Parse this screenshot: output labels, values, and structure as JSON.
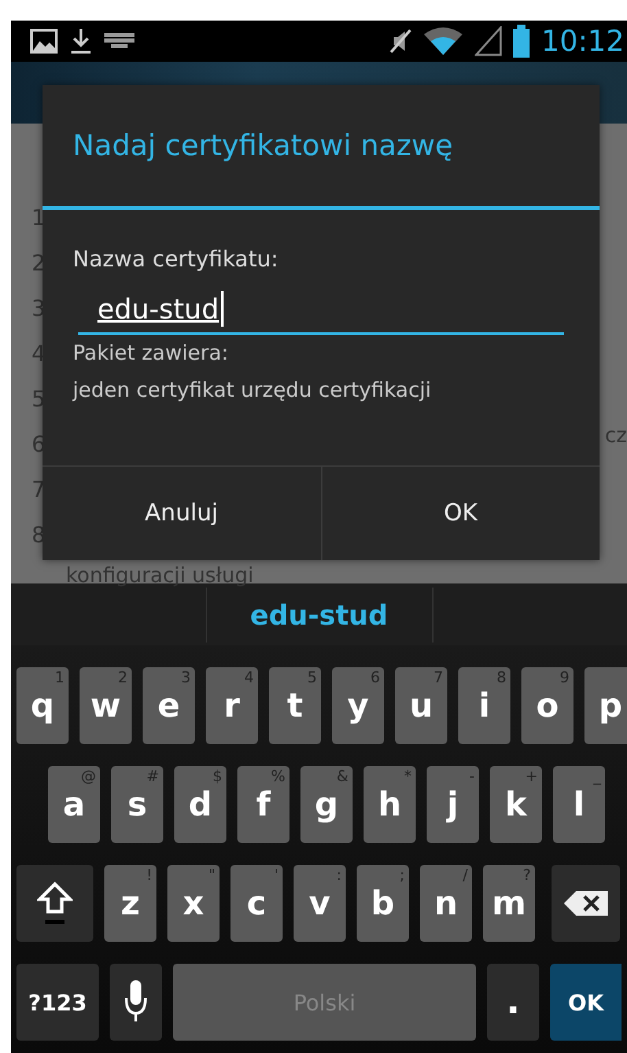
{
  "status_bar": {
    "time": "10:12"
  },
  "background": {
    "list_numbers": [
      "1",
      "2",
      "3",
      "4",
      "5",
      "6",
      "7",
      "8"
    ],
    "trailing_text": "cz",
    "bottom_text": "konfiguracji usługi"
  },
  "dialog": {
    "title": "Nadaj certyfikatowi nazwę",
    "field_label": "Nazwa certyfikatu:",
    "field_value": "edu-stud",
    "info_heading": "Pakiet zawiera:",
    "info_text": "jeden certyfikat urzędu certyfikacji",
    "buttons": [
      "Anuluj",
      "OK"
    ]
  },
  "suggestion_bar": {
    "suggestion": "edu-stud"
  },
  "keyboard": {
    "letter_rows": [
      [
        {
          "kind": "letter",
          "label": "q",
          "hint": "1"
        },
        {
          "kind": "letter",
          "label": "w",
          "hint": "2"
        },
        {
          "kind": "letter",
          "label": "e",
          "hint": "3"
        },
        {
          "kind": "letter",
          "label": "r",
          "hint": "4"
        },
        {
          "kind": "letter",
          "label": "t",
          "hint": "5"
        },
        {
          "kind": "letter",
          "label": "y",
          "hint": "6"
        },
        {
          "kind": "letter",
          "label": "u",
          "hint": "7"
        },
        {
          "kind": "letter",
          "label": "i",
          "hint": "8"
        },
        {
          "kind": "letter",
          "label": "o",
          "hint": "9"
        },
        {
          "kind": "letter",
          "label": "p"
        }
      ],
      [
        {
          "kind": "letter",
          "label": "a",
          "hint": "@"
        },
        {
          "kind": "letter",
          "label": "s",
          "hint": "#"
        },
        {
          "kind": "letter",
          "label": "d",
          "hint": "$"
        },
        {
          "kind": "letter",
          "label": "f",
          "hint": "%"
        },
        {
          "kind": "letter",
          "label": "g",
          "hint": "&"
        },
        {
          "kind": "letter",
          "label": "h",
          "hint": "*"
        },
        {
          "kind": "letter",
          "label": "j",
          "hint": "-"
        },
        {
          "kind": "letter",
          "label": "k",
          "hint": "+"
        },
        {
          "kind": "letter",
          "label": "l",
          "hint": "_"
        }
      ],
      [
        {
          "kind": "shift"
        },
        {
          "kind": "letter",
          "label": "z",
          "hint": "!"
        },
        {
          "kind": "letter",
          "label": "x",
          "hint": "\""
        },
        {
          "kind": "letter",
          "label": "c",
          "hint": "'"
        },
        {
          "kind": "letter",
          "label": "v",
          "hint": ":"
        },
        {
          "kind": "letter",
          "label": "b",
          "hint": ";"
        },
        {
          "kind": "letter",
          "label": "n",
          "hint": "/"
        },
        {
          "kind": "letter",
          "label": "m",
          "hint": "?"
        },
        {
          "kind": "backspace"
        }
      ]
    ],
    "bottom_row": [
      {
        "kind": "symbols",
        "label": "?123"
      },
      {
        "kind": "mic"
      },
      {
        "kind": "space",
        "label": "Polski"
      },
      {
        "kind": "period",
        "label": "."
      },
      {
        "kind": "enter",
        "label": "OK"
      }
    ]
  }
}
